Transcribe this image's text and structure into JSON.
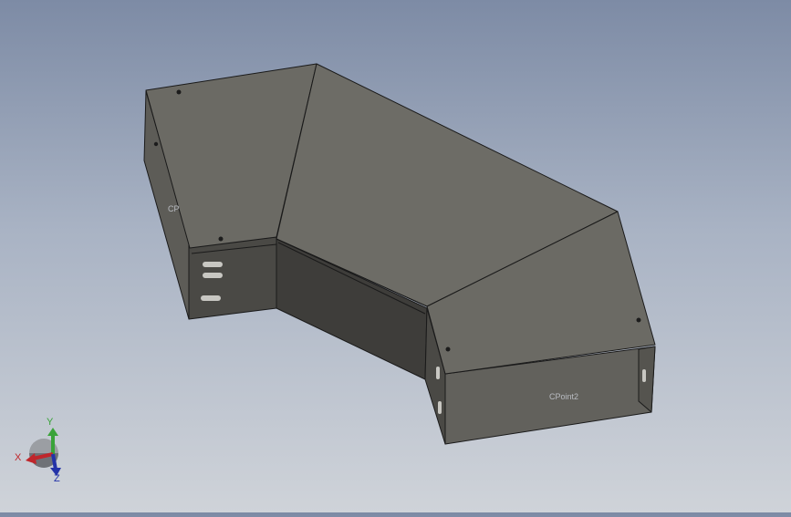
{
  "viewport": {
    "background_top": "#7d8ba5",
    "background_bottom": "#cfd3d9"
  },
  "model": {
    "top_face_color": "#6b6a64",
    "side_face_color": "#3e3d3a",
    "inner_face_color": "#5d5c57",
    "edge_color": "#1a1a1a",
    "points": {
      "cpoint_left": "CP",
      "cpoint_right": "CPoint2"
    }
  },
  "triad": {
    "x_label": "X",
    "y_label": "Y",
    "z_label": "Z",
    "x_color": "#c0262b",
    "y_color": "#3aa33a",
    "z_color": "#2433a8",
    "x_icon": "x-axis-arrow",
    "y_icon": "y-axis-arrow",
    "z_icon": "z-axis-arrow"
  }
}
